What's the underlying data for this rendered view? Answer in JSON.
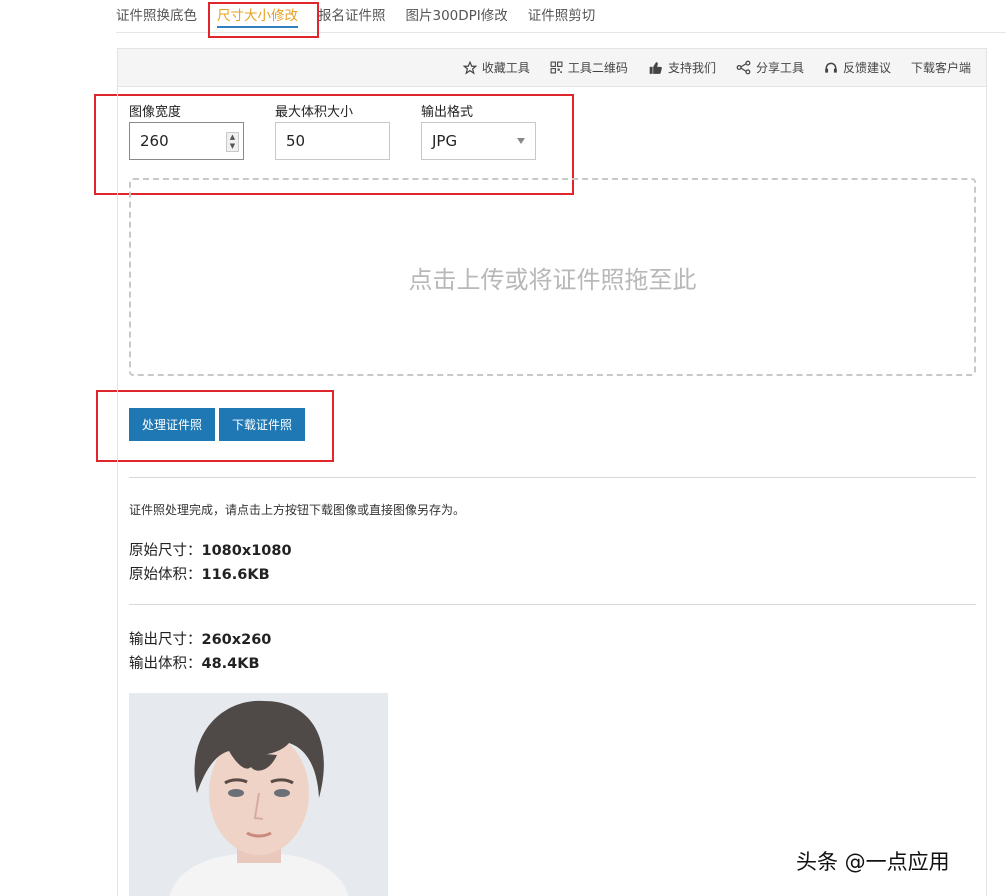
{
  "tabs": [
    {
      "label": "证件照换底色",
      "active": false
    },
    {
      "label": "尺寸大小修改",
      "active": true
    },
    {
      "label": "报名证件照",
      "active": false
    },
    {
      "label": "图片300DPI修改",
      "active": false
    },
    {
      "label": "证件照剪切",
      "active": false
    }
  ],
  "toolbar": {
    "favorite": "收藏工具",
    "qrcode": "工具二维码",
    "support": "支持我们",
    "share": "分享工具",
    "feedback": "反馈建议",
    "download_client": "下载客户端"
  },
  "form": {
    "width_label": "图像宽度",
    "width_value": "260",
    "maxsize_label": "最大体积大小",
    "maxsize_value": "50",
    "format_label": "输出格式",
    "format_value": "JPG"
  },
  "dropzone": {
    "text": "点击上传或将证件照拖至此"
  },
  "buttons": {
    "process": "处理证件照",
    "download": "下载证件照"
  },
  "result": {
    "status": "证件照处理完成，请点击上方按钮下载图像或直接图像另存为。",
    "orig_size_label": "原始尺寸：",
    "orig_size_value": "1080x1080",
    "orig_weight_label": "原始体积：",
    "orig_weight_value": "116.6KB",
    "out_size_label": "输出尺寸：",
    "out_size_value": "260x260",
    "out_weight_label": "输出体积：",
    "out_weight_value": "48.4KB"
  },
  "watermark": "头条 @一点应用",
  "colors": {
    "accent_tab": "#e8a01f",
    "button": "#1f78b4",
    "annotation": "#e0262a"
  }
}
